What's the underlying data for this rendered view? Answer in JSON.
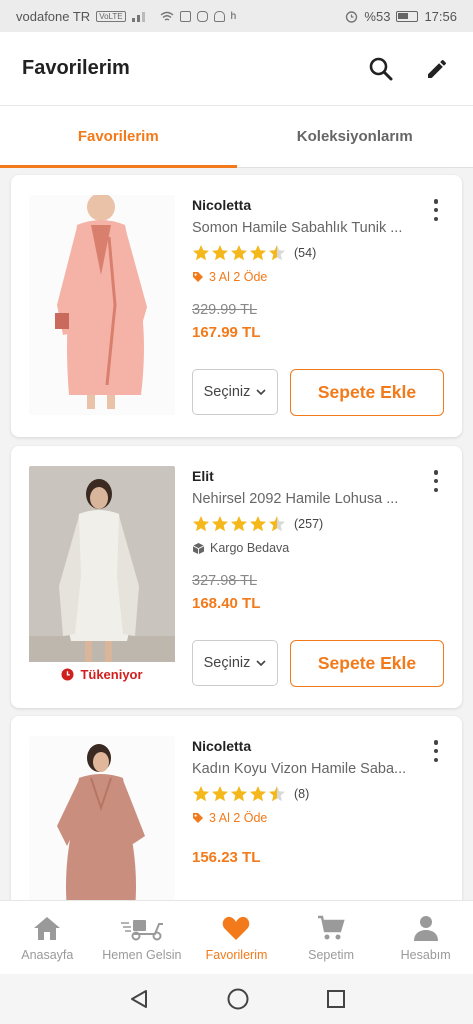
{
  "status_bar": {
    "carrier": "vodafone TR",
    "volte": "VoLTE",
    "network": "h",
    "battery": "%53",
    "time": "17:56"
  },
  "header": {
    "title": "Favorilerim"
  },
  "tabs": [
    {
      "label": "Favorilerim",
      "active": true
    },
    {
      "label": "Koleksiyonlarım",
      "active": false
    }
  ],
  "products": [
    {
      "brand": "Nicoletta",
      "name": "Somon Hamile Sabahlık Tunik ...",
      "rating": 4.5,
      "review_count": "(54)",
      "promo_icon": "tag-icon",
      "promo": "3 Al 2 Öde",
      "old_price": "329.99 TL",
      "price": "167.99 TL",
      "select_label": "Seçiniz",
      "add_label": "Sepete Ekle"
    },
    {
      "brand": "Elit",
      "name": "Nehirsel 2092 Hamile Lohusa ...",
      "rating": 4.5,
      "review_count": "(257)",
      "promo_icon": "package-icon",
      "promo": "Kargo Bedava",
      "old_price": "327.98 TL",
      "price": "168.40 TL",
      "badge": "Tükeniyor",
      "select_label": "Seçiniz",
      "add_label": "Sepete Ekle"
    },
    {
      "brand": "Nicoletta",
      "name": "Kadın Koyu Vizon Hamile Saba...",
      "rating": 4.5,
      "review_count": "(8)",
      "promo_icon": "tag-icon",
      "promo": "3 Al 2 Öde",
      "price": "156.23 TL"
    }
  ],
  "bottom_nav": [
    {
      "label": "Anasayfa",
      "icon": "home-icon",
      "active": false
    },
    {
      "label": "Hemen Gelsin",
      "icon": "scooter-icon",
      "active": false
    },
    {
      "label": "Favorilerim",
      "icon": "heart-icon",
      "active": true
    },
    {
      "label": "Sepetim",
      "icon": "cart-icon",
      "active": false
    },
    {
      "label": "Hesabım",
      "icon": "user-icon",
      "active": false
    }
  ],
  "colors": {
    "accent": "#f27a1a",
    "star": "#f5b81c",
    "danger": "#d01f1f"
  }
}
